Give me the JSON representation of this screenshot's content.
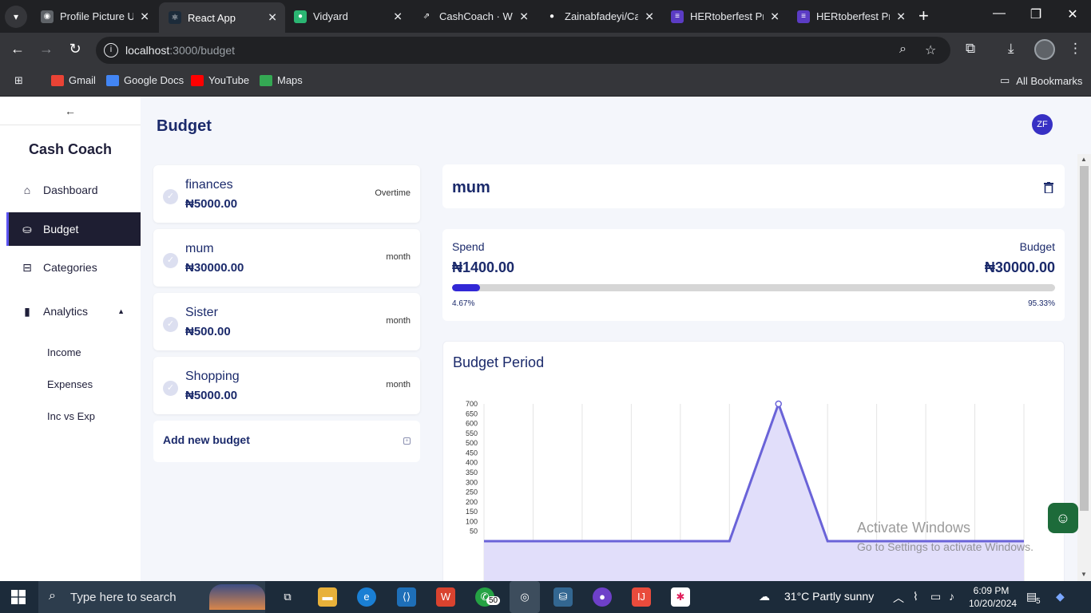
{
  "browser": {
    "tabs": [
      {
        "title": "Profile Picture U",
        "color": "#5f6368",
        "glyph": "◉"
      },
      {
        "title": "React App",
        "color": "#1c2b3a",
        "glyph": "⚛"
      },
      {
        "title": "Vidyard",
        "color": "#2bb673",
        "glyph": "●"
      },
      {
        "title": "CashCoach · We",
        "color": "#202124",
        "glyph": "⇗"
      },
      {
        "title": "Zainabfadeyi/Ca",
        "color": "#202124",
        "glyph": "●"
      },
      {
        "title": "HERtoberfest Pr",
        "color": "#5b3cc4",
        "glyph": "≡"
      },
      {
        "title": "HERtoberfest Pr",
        "color": "#5b3cc4",
        "glyph": "≡"
      }
    ],
    "url_host": "localhost",
    "url_path": ":3000/budget",
    "bookmarks": [
      {
        "label": "Gmail",
        "color": "#ea4335"
      },
      {
        "label": "Google Docs",
        "color": "#4285f4"
      },
      {
        "label": "YouTube",
        "color": "#ff0000"
      },
      {
        "label": "Maps",
        "color": "#34a853"
      }
    ],
    "all_bookmarks": "All Bookmarks"
  },
  "sidebar": {
    "collapse_glyph": "←",
    "brand": "Cash Coach",
    "items": [
      {
        "label": "Dashboard",
        "icon": "home-icon"
      },
      {
        "label": "Budget",
        "icon": "coins-icon"
      },
      {
        "label": "Categories",
        "icon": "inbox-icon"
      },
      {
        "label": "Analytics",
        "icon": "bar-chart-icon"
      }
    ],
    "sub_items": [
      "Income",
      "Expenses",
      "Inc vs Exp"
    ]
  },
  "header": {
    "title": "Budget",
    "avatar_initials": "ZF"
  },
  "budgets": [
    {
      "name": "finances",
      "amount": "₦5000.00",
      "period": "Overtime"
    },
    {
      "name": "mum",
      "amount": "₦30000.00",
      "period": "month"
    },
    {
      "name": "Sister",
      "amount": "₦500.00",
      "period": "month"
    },
    {
      "name": "Shopping",
      "amount": "₦5000.00",
      "period": "month"
    }
  ],
  "add_budget_label": "Add new budget",
  "detail": {
    "name": "mum",
    "spend_label": "Spend",
    "budget_label": "Budget",
    "spend_value": "₦1400.00",
    "budget_value": "₦30000.00",
    "spent_pct_label": "4.67%",
    "remaining_pct_label": "95.33%",
    "spent_fraction": 0.0467
  },
  "chart_data": {
    "type": "area",
    "title": "Budget Period",
    "y_ticks": [
      700,
      650,
      600,
      550,
      500,
      450,
      400,
      350,
      300,
      250,
      200,
      150,
      100,
      50
    ],
    "ylim": [
      0,
      700
    ],
    "x_count": 12,
    "values": [
      0,
      0,
      0,
      0,
      0,
      0,
      700,
      0,
      0,
      0,
      0,
      0
    ],
    "line_color": "#6a63d8",
    "fill_color": "#e1defa",
    "grid": true
  },
  "watermark": {
    "line1": "Activate Windows",
    "line2": "Go to Settings to activate Windows."
  },
  "taskbar": {
    "search_placeholder": "Type here to search",
    "whatsapp_badge": "50",
    "weather": "31°C  Partly sunny",
    "time": "6:09 PM",
    "date": "10/20/2024",
    "notif_count": "5"
  },
  "colors": {
    "accent": "#3228d6",
    "title": "#1b2a6b",
    "sidebar_active": "#1e1e32"
  }
}
